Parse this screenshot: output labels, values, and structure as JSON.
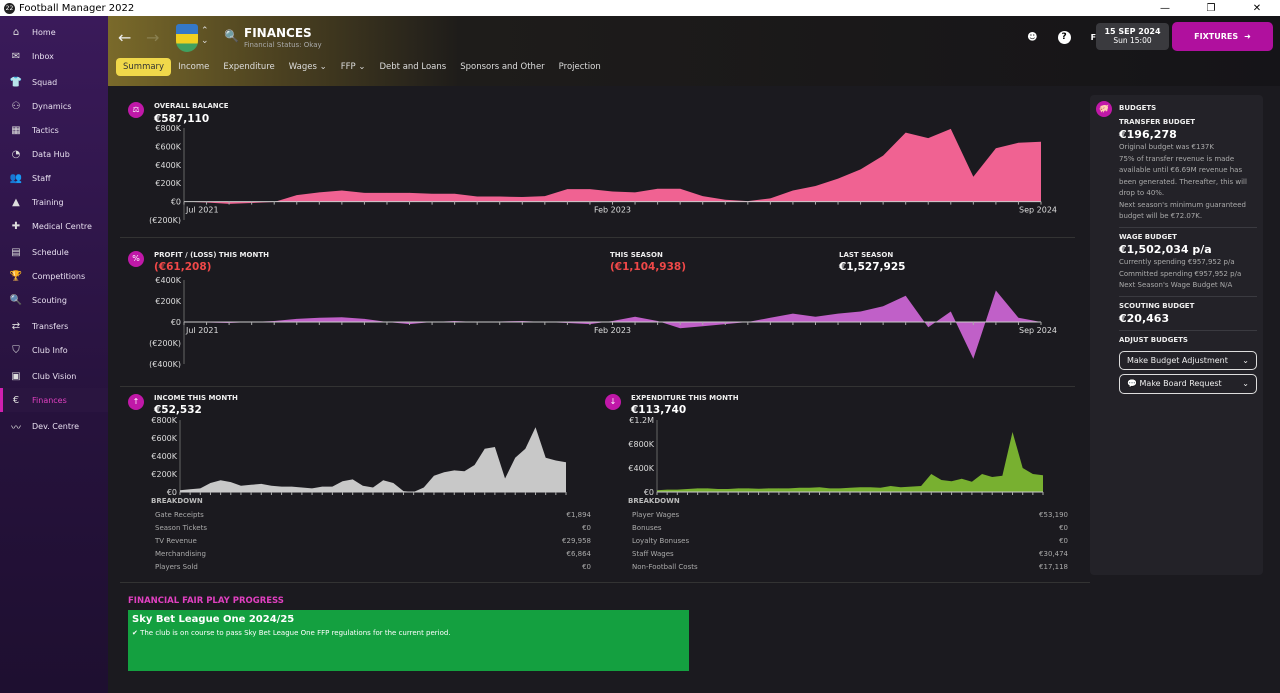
{
  "window": {
    "title": "Football Manager 2022",
    "controls": [
      "—",
      "❐",
      "✕"
    ]
  },
  "sidebar": {
    "items": [
      {
        "label": "Home",
        "icon": "⌂"
      },
      {
        "label": "Inbox",
        "icon": "✉"
      },
      {
        "label": "Squad",
        "icon": "👕"
      },
      {
        "label": "Dynamics",
        "icon": "⚇"
      },
      {
        "label": "Tactics",
        "icon": "▦"
      },
      {
        "label": "Data Hub",
        "icon": "◔"
      },
      {
        "label": "Staff",
        "icon": "👥"
      },
      {
        "label": "Training",
        "icon": "▲"
      },
      {
        "label": "Medical Centre",
        "icon": "✚"
      },
      {
        "label": "Schedule",
        "icon": "▤"
      },
      {
        "label": "Competitions",
        "icon": "🏆"
      },
      {
        "label": "Scouting",
        "icon": "🔍"
      },
      {
        "label": "Transfers",
        "icon": "⇄"
      },
      {
        "label": "Club Info",
        "icon": "⛉"
      },
      {
        "label": "Club Vision",
        "icon": "▣"
      },
      {
        "label": "Finances",
        "icon": "€"
      },
      {
        "label": "Dev. Centre",
        "icon": "〰"
      }
    ]
  },
  "header": {
    "title": "FINANCES",
    "subtitle": "Financial Status: Okay",
    "date": "15 SEP 2024",
    "time": "Sun 15:00",
    "fixtures": "FIXTURES",
    "fm": "FM",
    "help": "?",
    "tabs": [
      "Summary",
      "Income",
      "Expenditure",
      "Wages ⌄",
      "FFP ⌄",
      "Debt and Loans",
      "Sponsors and Other",
      "Projection"
    ]
  },
  "overall": {
    "label": "OVERALL BALANCE",
    "value": "€587,110"
  },
  "profit": {
    "label": "PROFIT / (LOSS) THIS MONTH",
    "value": "(€61,208)",
    "season_label": "THIS SEASON",
    "season_value": "(€1,104,938)",
    "last_label": "LAST SEASON",
    "last_value": "€1,527,925"
  },
  "income": {
    "label": "INCOME THIS MONTH",
    "value": "€52,532",
    "breakdown_label": "BREAKDOWN",
    "rows": [
      [
        "Gate Receipts",
        "€1,894"
      ],
      [
        "Season Tickets",
        "€0"
      ],
      [
        "TV Revenue",
        "€29,958"
      ],
      [
        "Merchandising",
        "€6,864"
      ],
      [
        "Players Sold",
        "€0"
      ]
    ]
  },
  "expenditure": {
    "label": "EXPENDITURE THIS MONTH",
    "value": "€113,740",
    "breakdown_label": "BREAKDOWN",
    "rows": [
      [
        "Player Wages",
        "€53,190"
      ],
      [
        "Bonuses",
        "€0"
      ],
      [
        "Loyalty Bonuses",
        "€0"
      ],
      [
        "Staff Wages",
        "€30,474"
      ],
      [
        "Non-Football Costs",
        "€17,118"
      ]
    ]
  },
  "budgets": {
    "title": "BUDGETS",
    "transfer_label": "TRANSFER BUDGET",
    "transfer_value": "€196,278",
    "transfer_notes": [
      "Original budget was €137K",
      "75% of transfer revenue is made available until €6.69M revenue has been generated. Thereafter, this will drop to 40%.",
      "Next season's minimum guaranteed budget will be €72.07K."
    ],
    "wage_label": "WAGE BUDGET",
    "wage_value": "€1,502,034 p/a",
    "wage_notes": [
      "Currently spending €957,952 p/a",
      "Committed spending €957,952 p/a",
      "Next Season's Wage Budget N/A"
    ],
    "scouting_label": "SCOUTING BUDGET",
    "scouting_value": "€20,463",
    "adjust_label": "ADJUST BUDGETS",
    "adjust_button": "Make Budget Adjustment",
    "board_button": "Make Board Request"
  },
  "ffp": {
    "title": "FINANCIAL FAIR PLAY PROGRESS",
    "competition": "Sky Bet League One 2024/25",
    "message": "The club is on course to pass Sky Bet League One FFP regulations for the current period.",
    "color": "#14a040"
  },
  "chart_data": [
    {
      "type": "area",
      "name": "overall-balance",
      "color": "#f06292",
      "x_ticks": [
        "Jul 2021",
        "Feb 2023",
        "Sep 2024"
      ],
      "y_ticks": [
        "€800K",
        "€600K",
        "€400K",
        "€200K",
        "€0",
        "(€200K)"
      ],
      "ylim": [
        -200000,
        800000
      ],
      "values": [
        0,
        -10000,
        -25000,
        -15000,
        -5000,
        70000,
        100000,
        120000,
        95000,
        95000,
        95000,
        85000,
        85000,
        55000,
        55000,
        50000,
        60000,
        135000,
        135000,
        110000,
        100000,
        140000,
        140000,
        60000,
        20000,
        5000,
        35000,
        120000,
        170000,
        250000,
        350000,
        500000,
        750000,
        690000,
        790000,
        270000,
        580000,
        640000,
        650000
      ]
    },
    {
      "type": "area",
      "name": "profit-loss",
      "color": "#c060c8",
      "x_ticks": [
        "Jul 2021",
        "Feb 2023",
        "Sep 2024"
      ],
      "y_ticks": [
        "€400K",
        "€200K",
        "€0",
        "(€200K)",
        "(€400K)"
      ],
      "ylim": [
        -400000,
        400000
      ],
      "values": [
        0,
        -5000,
        -10000,
        0,
        10000,
        30000,
        40000,
        45000,
        30000,
        0,
        -20000,
        0,
        10000,
        0,
        5000,
        10000,
        0,
        -10000,
        -20000,
        10000,
        50000,
        10000,
        -60000,
        -40000,
        -20000,
        0,
        40000,
        80000,
        50000,
        80000,
        100000,
        150000,
        250000,
        -50000,
        100000,
        -350000,
        300000,
        40000,
        0
      ]
    },
    {
      "type": "area",
      "name": "income",
      "color": "#c8c8c8",
      "x_ticks": [
        "Jul 2021",
        "Feb 2023",
        "Sep 2024"
      ],
      "y_ticks": [
        "€800K",
        "€600K",
        "€400K",
        "€200K",
        "€0"
      ],
      "ylim": [
        0,
        800000
      ],
      "values": [
        20000,
        30000,
        40000,
        100000,
        130000,
        110000,
        70000,
        80000,
        90000,
        70000,
        60000,
        60000,
        50000,
        40000,
        60000,
        60000,
        120000,
        140000,
        70000,
        50000,
        130000,
        100000,
        10000,
        0,
        50000,
        180000,
        220000,
        240000,
        230000,
        300000,
        480000,
        500000,
        150000,
        380000,
        480000,
        720000,
        380000,
        350000,
        330000
      ]
    },
    {
      "type": "area",
      "name": "expenditure",
      "color": "#78b030",
      "x_ticks": [
        "Jul 2021",
        "Feb 2023",
        "Sep 2024"
      ],
      "y_ticks": [
        "€1.2M",
        "€800K",
        "€400K",
        "€0"
      ],
      "ylim": [
        0,
        1200000
      ],
      "values": [
        30000,
        40000,
        40000,
        50000,
        60000,
        60000,
        50000,
        50000,
        60000,
        60000,
        55000,
        60000,
        60000,
        60000,
        70000,
        70000,
        80000,
        60000,
        60000,
        70000,
        80000,
        80000,
        70000,
        100000,
        80000,
        90000,
        100000,
        300000,
        200000,
        180000,
        220000,
        170000,
        300000,
        250000,
        270000,
        1000000,
        400000,
        300000,
        280000
      ]
    }
  ]
}
